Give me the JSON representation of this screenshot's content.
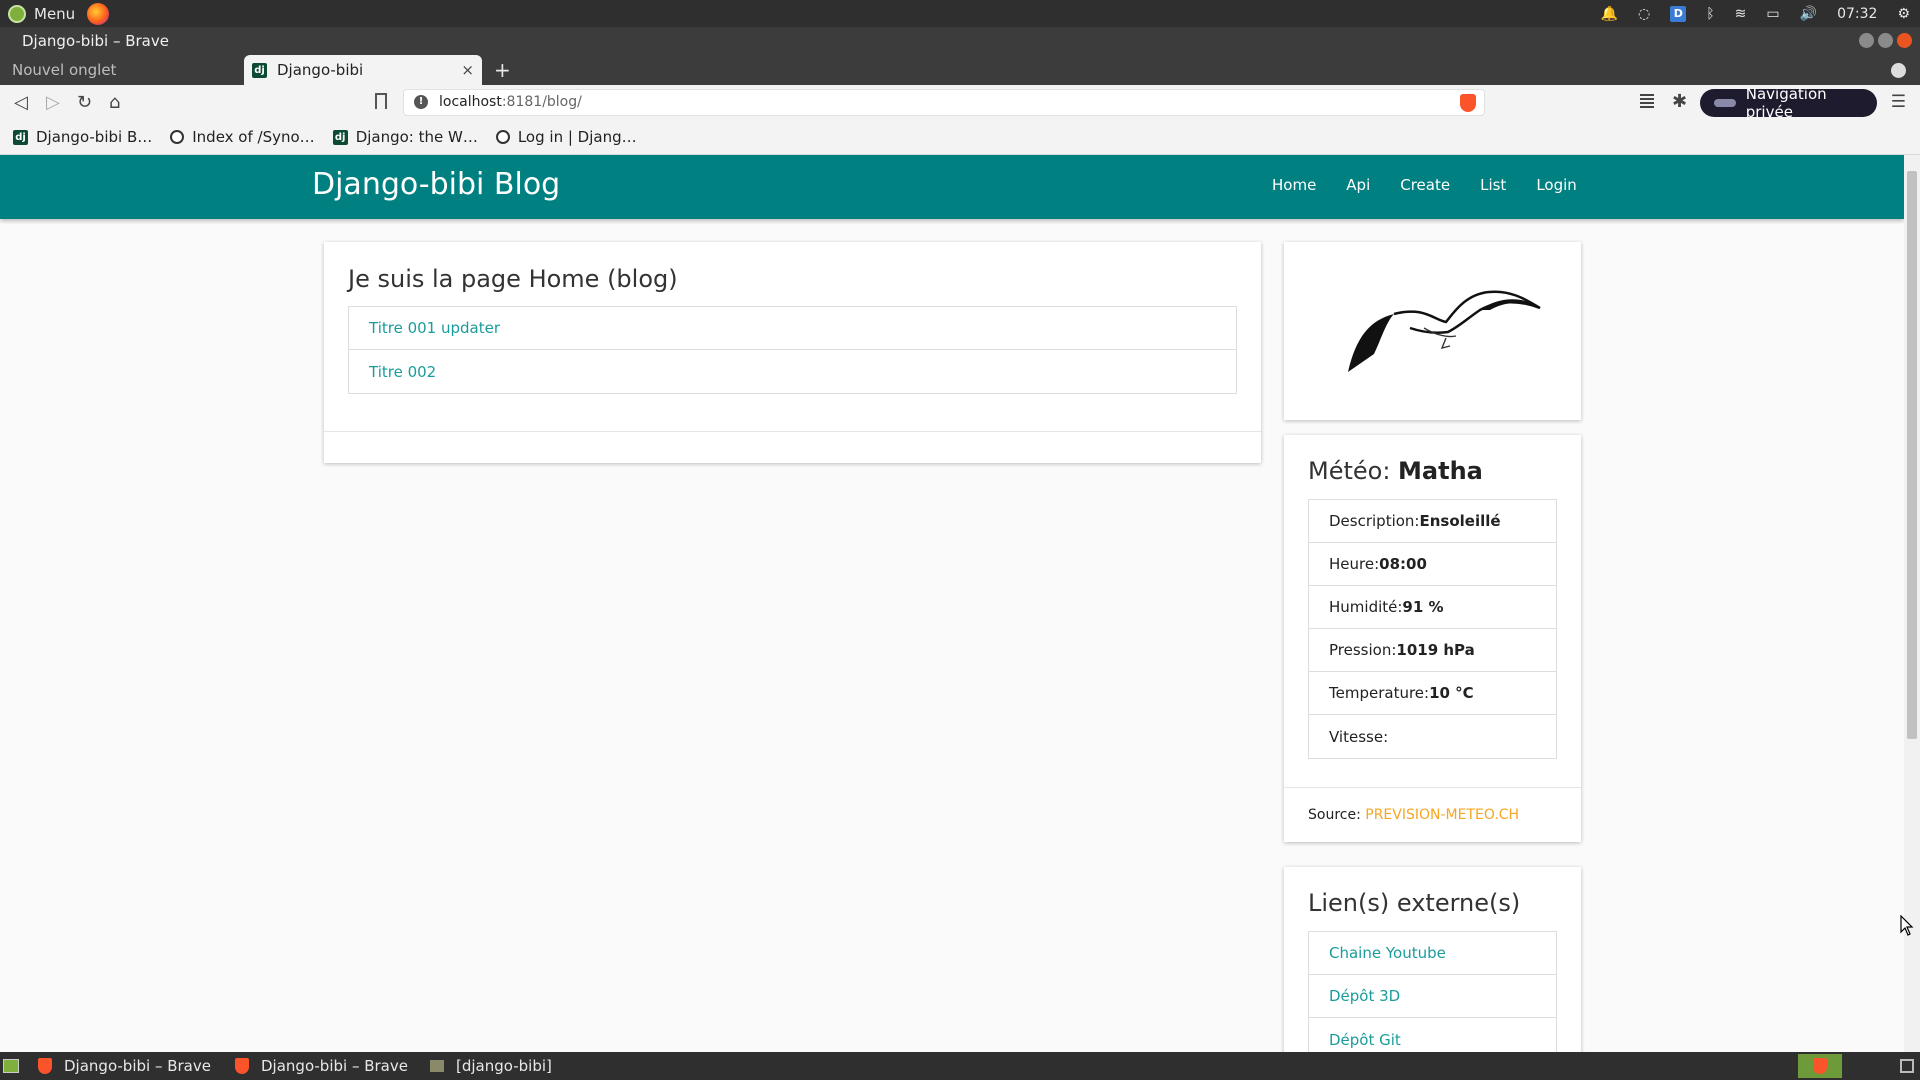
{
  "os": {
    "menu_label": "Menu",
    "clock": "07:32",
    "tray_d_label": "D"
  },
  "window": {
    "title": "Django-bibi – Brave"
  },
  "tabs": {
    "inactive_label": "Nouvel onglet",
    "active_label": "Django-bibi",
    "close_glyph": "×",
    "new_tab_glyph": "+"
  },
  "toolbar": {
    "url_host": "localhost",
    "url_path": ":8181/blog/",
    "private_label": "Navigation privée"
  },
  "bookmarks": [
    {
      "label": "Django-bibi B…",
      "icon": "django-icon"
    },
    {
      "label": "Index of /Syno…",
      "icon": "globe-icon"
    },
    {
      "label": "Django: the W…",
      "icon": "django-icon"
    },
    {
      "label": "Log in | Djang…",
      "icon": "globe-icon"
    }
  ],
  "site": {
    "brand": "Django-bibi Blog",
    "nav": [
      "Home",
      "Api",
      "Create",
      "List",
      "Login"
    ]
  },
  "main": {
    "heading": "Je suis la page Home (blog)",
    "posts": [
      "Titre 001 updater",
      "Titre 002"
    ]
  },
  "weather": {
    "heading_prefix": "Météo: ",
    "city": "Matha",
    "rows": [
      {
        "label": "Description: ",
        "value": "Ensoleillé"
      },
      {
        "label": "Heure: ",
        "value": "08:00"
      },
      {
        "label": "Humidité: ",
        "value": "91 %"
      },
      {
        "label": "Pression: ",
        "value": "1019 hPa"
      },
      {
        "label": "Temperature: ",
        "value": "10 °C"
      },
      {
        "label": "Vitesse: ",
        "value": ""
      }
    ],
    "source_label": "Source: ",
    "source_link": "PREVISION-METEO.CH"
  },
  "links": {
    "heading": "Lien(s) externe(s)",
    "items": [
      "Chaine Youtube",
      "Dépôt 3D",
      "Dépôt Git"
    ]
  },
  "taskbar": {
    "items": [
      "Django-bibi – Brave",
      "Django-bibi – Brave",
      "[django-bibi]"
    ]
  },
  "colors": {
    "navbar": "#008080",
    "link": "#1a9c9c",
    "source_link": "#f5a623"
  }
}
